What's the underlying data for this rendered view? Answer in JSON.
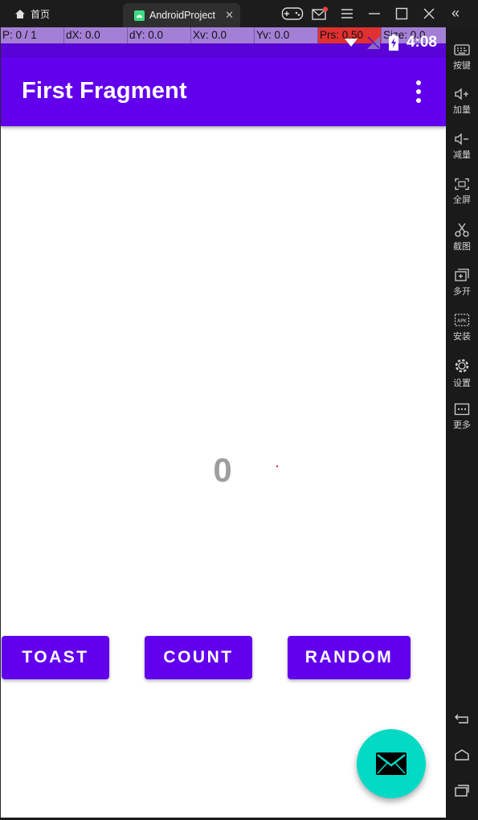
{
  "window": {
    "home_tab_label": "首页",
    "app_tab_label": "AndroidProject",
    "collapse_glyph": "«"
  },
  "toolbar_icons": [
    "gamepad-icon",
    "mail-icon",
    "menu-icon",
    "minimize-icon",
    "maximize-icon",
    "close-icon"
  ],
  "sidebar": {
    "items": [
      {
        "icon": "keyboard-icon",
        "label": "按键"
      },
      {
        "icon": "volume-up-icon",
        "label": "加量"
      },
      {
        "icon": "volume-down-icon",
        "label": "减量"
      },
      {
        "icon": "fullscreen-icon",
        "label": "全屏"
      },
      {
        "icon": "scissors-icon",
        "label": "截图"
      },
      {
        "icon": "multi-instance-icon",
        "label": "多开"
      },
      {
        "icon": "apk-install-icon",
        "label": "安装"
      },
      {
        "icon": "settings-icon",
        "label": "设置"
      },
      {
        "icon": "more-icon",
        "label": "更多"
      }
    ],
    "nav": [
      "back-icon",
      "home-icon",
      "recents-icon"
    ]
  },
  "debug_overlay": {
    "p": "P: 0 / 1",
    "dx": "dX: 0.0",
    "dy": "dY: 0.0",
    "xv": "Xv: 0.0",
    "yv": "Yv: 0.0",
    "prs": "Prs: 0.50",
    "size": "Size: 0.0"
  },
  "status_bar": {
    "time": "4:08",
    "icons": [
      "wifi-icon",
      "no-signal-icon",
      "battery-charging-icon"
    ]
  },
  "app_bar": {
    "title": "First Fragment",
    "menu_icon": "overflow-menu-icon"
  },
  "content": {
    "count_value": "0"
  },
  "buttons": {
    "toast": "TOAST",
    "count": "COUNT",
    "random": "RANDOM"
  },
  "fab": {
    "icon": "email-icon"
  },
  "colors": {
    "primary": "#6200ee",
    "status_bar": "#5a03d6",
    "fab": "#03dac5",
    "counter_text": "#9e9e9e"
  }
}
